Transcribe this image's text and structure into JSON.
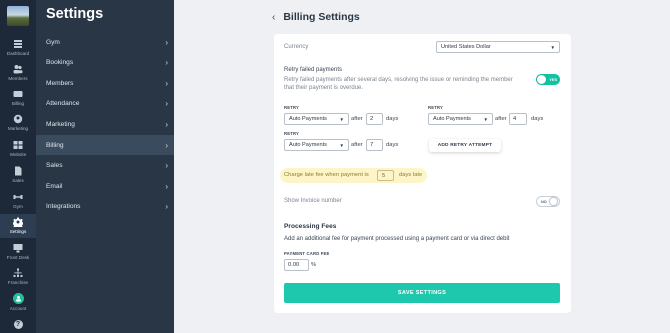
{
  "rail": {
    "items": [
      {
        "label": "Dashboard",
        "icon": "dashboard-icon"
      },
      {
        "label": "Members",
        "icon": "members-icon"
      },
      {
        "label": "Billing",
        "icon": "billing-icon"
      },
      {
        "label": "Marketing",
        "icon": "marketing-icon"
      },
      {
        "label": "Website",
        "icon": "website-icon"
      },
      {
        "label": "Sales",
        "icon": "sales-icon"
      },
      {
        "label": "Gym",
        "icon": "gym-icon"
      },
      {
        "label": "Settings",
        "icon": "gear-icon"
      },
      {
        "label": "Front Desk",
        "icon": "front-desk-icon"
      },
      {
        "label": "Franchise",
        "icon": "franchise-icon"
      },
      {
        "label": "Account",
        "icon": "account-icon"
      }
    ],
    "help": "?"
  },
  "menu": {
    "title": "Settings",
    "items": [
      {
        "label": "Gym"
      },
      {
        "label": "Bookings"
      },
      {
        "label": "Members"
      },
      {
        "label": "Attendance"
      },
      {
        "label": "Marketing"
      },
      {
        "label": "Billing"
      },
      {
        "label": "Sales"
      },
      {
        "label": "Email"
      },
      {
        "label": "Integrations"
      }
    ],
    "chevron": "›"
  },
  "page": {
    "back": "‹",
    "title": "Billing Settings"
  },
  "form": {
    "currency_label": "Currency",
    "currency_value": "United States Dollar",
    "retry_title": "Retry failed payments",
    "retry_desc": "Retry failed payments after several days, resolving the issue or reminding the member that their payment is overdue.",
    "retry_toggle": "YES",
    "retry_label": "RETRY",
    "retries": [
      {
        "method": "Auto Payments",
        "after": "after",
        "days_value": "2",
        "days": "days"
      },
      {
        "method": "Auto Payments",
        "after": "after",
        "days_value": "4",
        "days": "days"
      },
      {
        "method": "Auto Payments",
        "after": "after",
        "days_value": "7",
        "days": "days"
      }
    ],
    "add_retry": "ADD RETRY ATTEMPT",
    "late_fee_prefix": "Charge late fee when payment is",
    "late_fee_value": "5",
    "late_fee_suffix": "days late",
    "invoice_label": "Show Invoice number",
    "invoice_toggle": "NO",
    "processing_title": "Processing Fees",
    "processing_desc": "Add an additional fee for payment processed using a payment card or via direct debit",
    "card_fee_label": "PAYMENT CARD FEE",
    "card_fee_value": "0.00",
    "card_fee_unit": "%",
    "save": "SAVE SETTINGS"
  },
  "colors": {
    "rail": "#1d2939",
    "menu": "#283646",
    "accent": "#1ec8ad",
    "highlight": "#fdf5c7"
  }
}
